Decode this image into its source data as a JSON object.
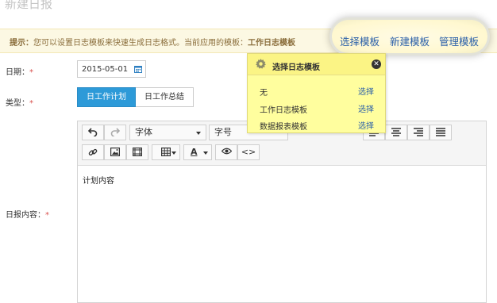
{
  "page": {
    "title": "新建日报"
  },
  "tip": {
    "prefix": "提示：",
    "message": "您可以设置日志模板来快速生成日志格式。当前应用的模板：",
    "current_template": "工作日志模板"
  },
  "template_links": {
    "select": "选择模板",
    "create": "新建模板",
    "manage": "管理模板"
  },
  "form": {
    "date_label": "日期：",
    "date_value": "2015-05-01",
    "type_label": "类型：",
    "type_options": [
      "日工作计划",
      "日工作总结"
    ],
    "type_selected": "日工作计划",
    "content_label": "日报内容：",
    "required_mark": "*"
  },
  "editor": {
    "font_select": "字体",
    "size_select": "字号",
    "content": "计划内容",
    "font_color_letter": "A",
    "code_label": "<>"
  },
  "popup": {
    "title": "选择日志模板",
    "close_glyph": "✕",
    "templates": [
      {
        "name": "无",
        "action": "选择"
      },
      {
        "name": "工作日志模板",
        "action": "选择"
      },
      {
        "name": "数据报表模板",
        "action": "选择"
      }
    ]
  },
  "colors": {
    "accent": "#2d9ad8",
    "link": "#2a5fa8",
    "tip_bg": "#fcf8e3",
    "popup_bg": "#fffe9e",
    "required": "#d9534f"
  }
}
